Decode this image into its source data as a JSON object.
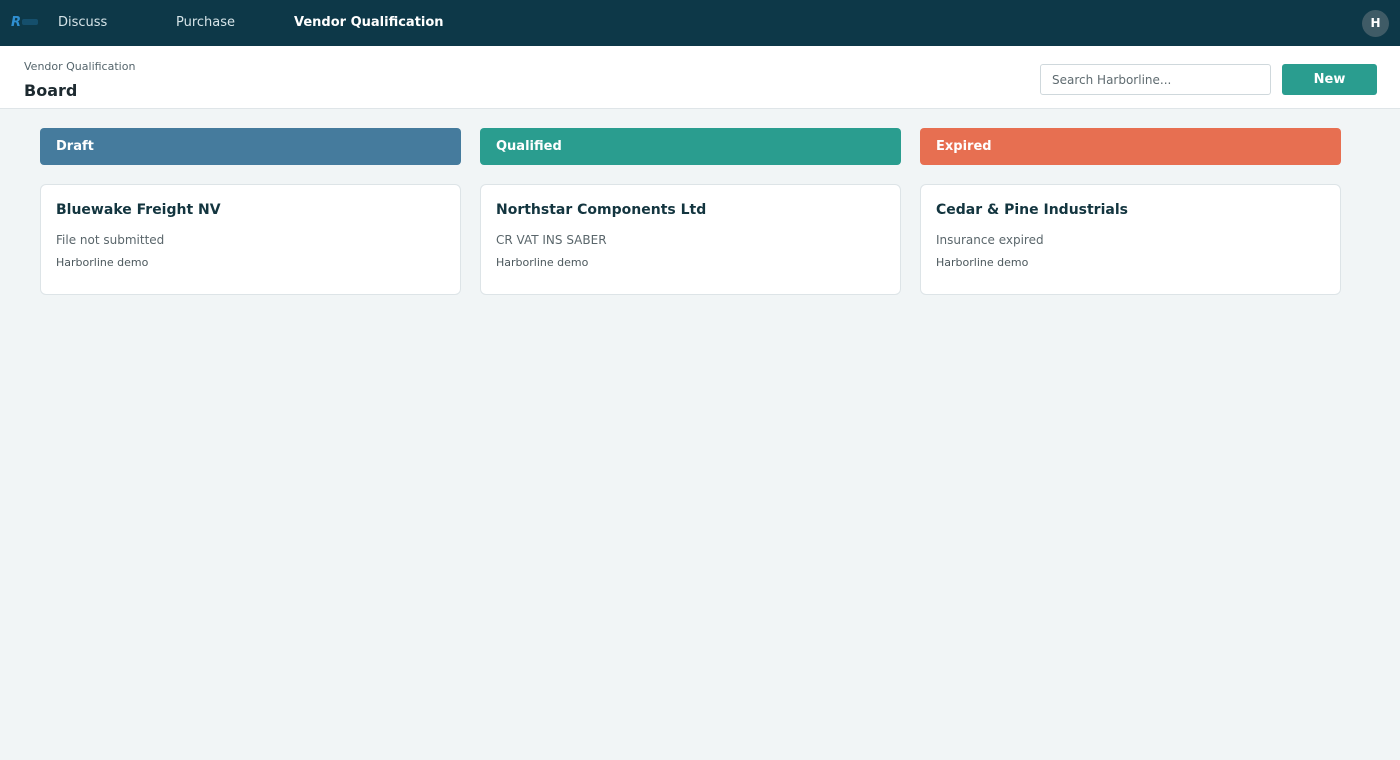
{
  "nav": {
    "items": [
      {
        "label": "Discuss"
      },
      {
        "label": "Purchase"
      },
      {
        "label": "Vendor Qualification",
        "active": true
      }
    ],
    "avatar_initial": "H"
  },
  "header": {
    "breadcrumb": "Vendor Qualification",
    "title": "Board",
    "search_placeholder": "Search Harborline...",
    "new_label": "New"
  },
  "columns": [
    {
      "label": "Draft",
      "color": "#457b9d",
      "cards": [
        {
          "title": "Bluewake Freight NV",
          "status": "File not submitted",
          "company": "Harborline demo"
        }
      ]
    },
    {
      "label": "Qualified",
      "color": "#2a9d8f",
      "cards": [
        {
          "title": "Northstar Components Ltd",
          "status": "CR VAT INS SABER",
          "company": "Harborline demo"
        }
      ]
    },
    {
      "label": "Expired",
      "color": "#e76f51",
      "cards": [
        {
          "title": "Cedar & Pine Industrials",
          "status": "Insurance expired",
          "company": "Harborline demo"
        }
      ]
    }
  ],
  "colors": {
    "topbar": "#0d3848",
    "accent": "#2a9d8f"
  },
  "icons": {
    "logo": "app-logo-icon"
  }
}
